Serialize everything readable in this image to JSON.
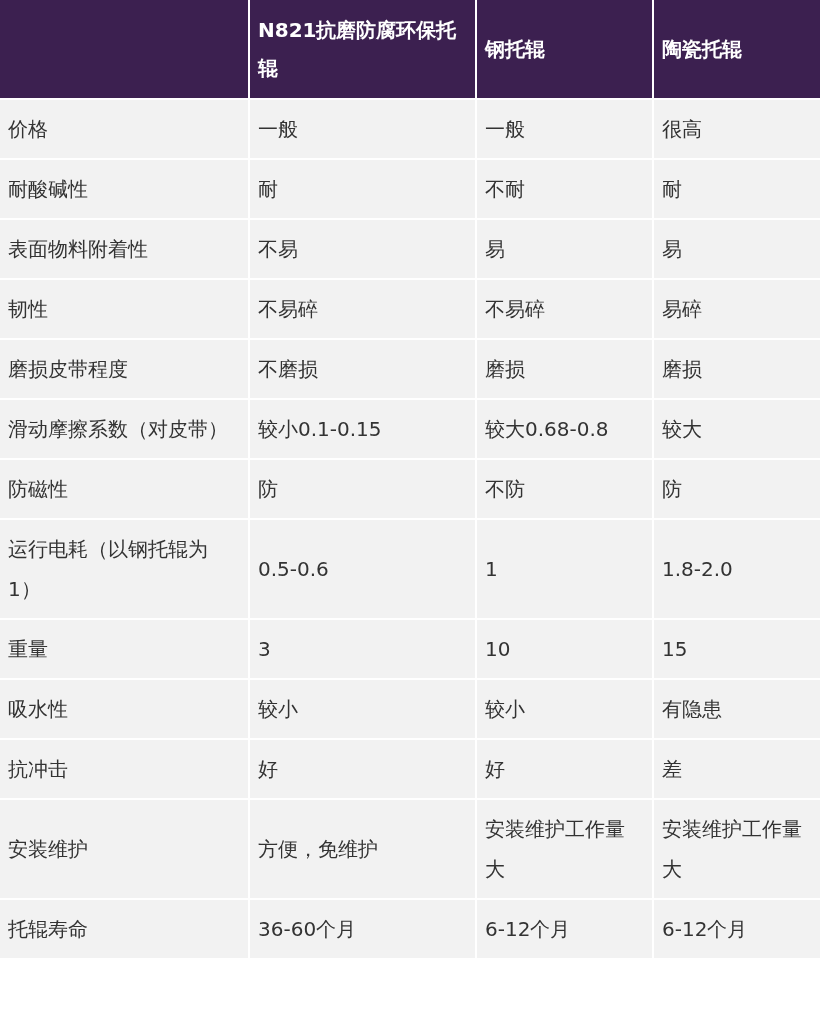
{
  "table": {
    "columns": [
      "",
      "N821抗磨防腐环保托辊",
      "钢托辊",
      "陶瓷托辊"
    ],
    "rows": [
      [
        "价格",
        "一般",
        "一般",
        "很高"
      ],
      [
        "耐酸碱性",
        "耐",
        "不耐",
        "耐"
      ],
      [
        "表面物料附着性",
        "不易",
        "易",
        "易"
      ],
      [
        "韧性",
        "不易碎",
        "不易碎",
        "易碎"
      ],
      [
        "磨损皮带程度",
        "不磨损",
        "磨损",
        "磨损"
      ],
      [
        "滑动摩擦系数（对皮带）",
        "较小0.1-0.15",
        "较大0.68-0.8",
        "较大"
      ],
      [
        "防磁性",
        "防",
        "不防",
        "防"
      ],
      [
        "运行电耗（以钢托辊为1）",
        "0.5-0.6",
        "1",
        "1.8-2.0"
      ],
      [
        "重量",
        "3",
        "10",
        "15"
      ],
      [
        "吸水性",
        "较小",
        "较小",
        "有隐患"
      ],
      [
        "抗冲击",
        "好",
        "好",
        "差"
      ],
      [
        "安装维护",
        "方便，免维护",
        "安装维护工作量大",
        "安装维护工作量大"
      ],
      [
        "托辊寿命",
        "36-60个月",
        "6-12个月",
        "6-12个月"
      ]
    ]
  }
}
